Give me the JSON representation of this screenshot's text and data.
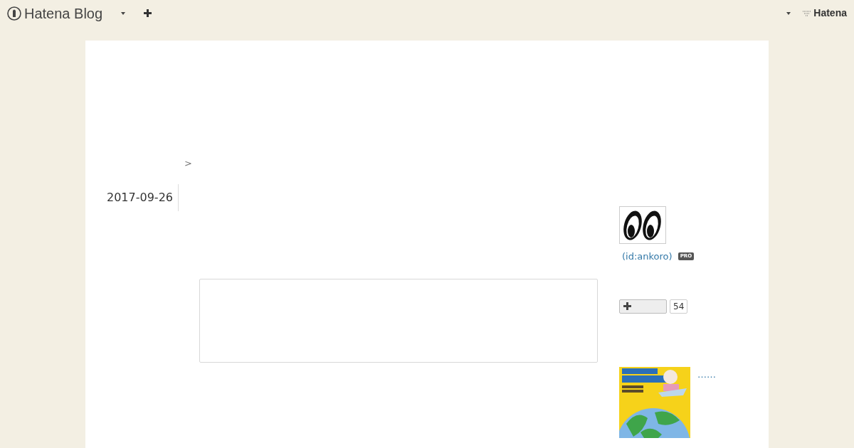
{
  "header": {
    "logo_text": "Hatena Blog",
    "brand": "Hatena"
  },
  "breadcrumb": {
    "separator": ">"
  },
  "entry": {
    "date": "2017-09-26"
  },
  "sidebar": {
    "profile": {
      "user_id": "(id:ankoro)",
      "badge": "PRO"
    },
    "bookmark": {
      "count": "54"
    },
    "book": {
      "link": "……"
    }
  }
}
